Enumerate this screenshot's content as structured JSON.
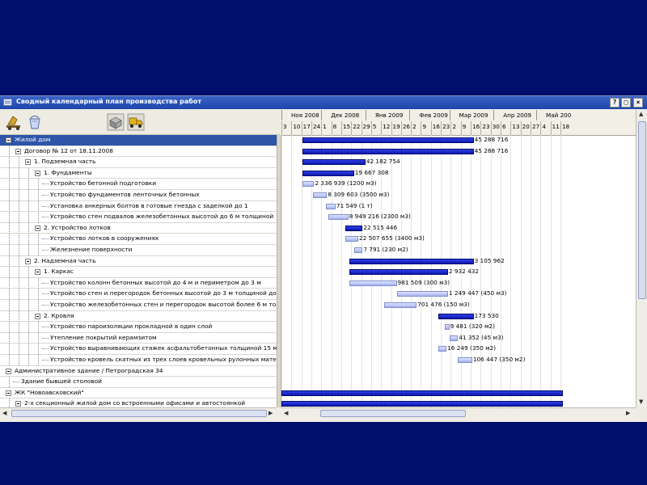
{
  "window": {
    "title": "Сводный календарный план производства работ",
    "buttons": [
      "?",
      "□",
      "×"
    ]
  },
  "toolbar": {
    "icons": [
      "cement-mixer-icon",
      "bucket-icon",
      "bricks-icon",
      "dump-truck-icon"
    ]
  },
  "tree": [
    {
      "label": "Жилой дом",
      "level": 0,
      "expanded": true,
      "selected": true
    },
    {
      "label": "Договор № 12 от 18.11.2008",
      "level": 1,
      "expanded": true
    },
    {
      "label": "1. Подземная часть",
      "level": 2,
      "expanded": true
    },
    {
      "label": "1. Фундаменты",
      "level": 3,
      "expanded": true
    },
    {
      "label": "Устройство бетонной подготовки",
      "level": 4
    },
    {
      "label": "Устройство фундаментов ленточных бетонных",
      "level": 4
    },
    {
      "label": "Установка анкерных болтов в готовые гнезда с заделкой до 1",
      "level": 4
    },
    {
      "label": "Устройство стен подвалов железобетонных высотой до 6 м толщиной",
      "level": 4
    },
    {
      "label": "2. Устройство лотков",
      "level": 3,
      "expanded": true
    },
    {
      "label": "Устройство лотков в сооружениях",
      "level": 4
    },
    {
      "label": "Железнение поверхности",
      "level": 4
    },
    {
      "label": "2. Надземная часть",
      "level": 2,
      "expanded": true
    },
    {
      "label": "1. Каркас",
      "level": 3,
      "expanded": true
    },
    {
      "label": "Устройство колонн бетонных высотой до 4 м и периметром до 3 м",
      "level": 4
    },
    {
      "label": "Устройство стен и перегородок бетонных высотой до 3 м толщиной до",
      "level": 4
    },
    {
      "label": "Устройство железобетонных стен и перегородок высотой более 6 м тол",
      "level": 4
    },
    {
      "label": "2. Кровля",
      "level": 3,
      "expanded": true
    },
    {
      "label": "Устройство пароизоляции прокладной в один слой",
      "level": 4
    },
    {
      "label": "Утепление покрытий керамзитом",
      "level": 4
    },
    {
      "label": "Устройство выравнивающих стяжек асфальтобетонных толщиной 15 м",
      "level": 4
    },
    {
      "label": "Устройство кровель скатных из трех слоев кровельных рулонных мате",
      "level": 4
    },
    {
      "label": "Административное здание / Петроградская 34",
      "level": 0,
      "expanded": true
    },
    {
      "label": "Здание бывшей столовой",
      "level": 1,
      "leafline": true
    },
    {
      "label": "ЖК \"Новоавсковский\"",
      "level": 0,
      "expanded": true
    },
    {
      "label": "2-х секционный жилой дом со встроенными офисами и автостоянкой",
      "level": 1,
      "expanded": true
    }
  ],
  "timeline": {
    "months": [
      "Ноя 2008",
      "Дек 2008",
      "Янв 2009",
      "Фев 2009",
      "Мар 2009",
      "Апр 2009",
      "Май 200"
    ],
    "days": [
      "3",
      "10",
      "17",
      "24",
      "1",
      "8",
      "15",
      "22",
      "29",
      "5",
      "12",
      "19",
      "26",
      "2",
      "9",
      "16",
      "23",
      "2",
      "9",
      "16",
      "23",
      "30",
      "6",
      "13",
      "20",
      "27",
      "4",
      "11",
      "18"
    ]
  },
  "bars": [
    {
      "row": 0,
      "type": "summary",
      "start": "2008-11-18",
      "end": "2009-03-18",
      "label": "45 288 716"
    },
    {
      "row": 1,
      "type": "summary",
      "start": "2008-11-18",
      "end": "2009-03-18",
      "label": "45 288 716"
    },
    {
      "row": 2,
      "type": "summary",
      "start": "2008-11-18",
      "end": "2009-01-01",
      "label": "42 182 754"
    },
    {
      "row": 3,
      "type": "summary",
      "start": "2008-11-18",
      "end": "2008-12-24",
      "label": "19 667 308"
    },
    {
      "row": 4,
      "type": "task",
      "start": "2008-11-18",
      "end": "2008-11-26",
      "label": "2 336 939 (1200 м3)"
    },
    {
      "row": 5,
      "type": "task",
      "start": "2008-11-25",
      "end": "2008-12-05",
      "label": "8 309 603 (3500 м3)"
    },
    {
      "row": 6,
      "type": "task",
      "start": "2008-12-04",
      "end": "2008-12-11",
      "label": "71 549 (1 т)"
    },
    {
      "row": 7,
      "type": "task",
      "start": "2008-12-06",
      "end": "2008-12-20",
      "label": "8 949 216 (2300 м3)"
    },
    {
      "row": 8,
      "type": "summary",
      "start": "2008-12-18",
      "end": "2008-12-30",
      "label": "22 515 446"
    },
    {
      "row": 9,
      "type": "task",
      "start": "2008-12-18",
      "end": "2008-12-27",
      "label": "22 507 655 (3400 м3)"
    },
    {
      "row": 10,
      "type": "task",
      "start": "2008-12-24",
      "end": "2008-12-30",
      "label": "7 791 (230 м2)"
    },
    {
      "row": 11,
      "type": "summary",
      "start": "2008-12-21",
      "end": "2009-03-18",
      "label": "3 105 962"
    },
    {
      "row": 12,
      "type": "summary",
      "start": "2008-12-21",
      "end": "2009-02-28",
      "label": "2 932 432"
    },
    {
      "row": 13,
      "type": "task",
      "start": "2008-12-21",
      "end": "2009-01-23",
      "label": "981 509 (300 м3)"
    },
    {
      "row": 14,
      "type": "task",
      "start": "2009-01-23",
      "end": "2009-02-28",
      "label": "1 249 447 (450 м3)"
    },
    {
      "row": 15,
      "type": "task",
      "start": "2009-01-14",
      "end": "2009-02-06",
      "label": "701 476 (150 м3)"
    },
    {
      "row": 16,
      "type": "summary",
      "start": "2009-02-21",
      "end": "2009-03-18",
      "label": "173 530"
    },
    {
      "row": 17,
      "type": "task",
      "start": "2009-02-26",
      "end": "2009-03-01",
      "label": "9 481 (320 м2)"
    },
    {
      "row": 18,
      "type": "task",
      "start": "2009-03-01",
      "end": "2009-03-07",
      "label": "41 352 (45 м3)"
    },
    {
      "row": 19,
      "type": "task",
      "start": "2009-02-21",
      "end": "2009-02-27",
      "label": "16 249 (350 м2)"
    },
    {
      "row": 20,
      "type": "task",
      "start": "2009-03-07",
      "end": "2009-03-17",
      "label": "106 447 (350 м2)"
    },
    {
      "row": 23,
      "type": "summary",
      "start": "2008-10-30",
      "end": "2009-05-20",
      "label": ""
    },
    {
      "row": 24,
      "type": "summary",
      "start": "2008-11-01",
      "end": "2009-05-20",
      "label": ""
    }
  ],
  "colors": {
    "background": "#000e6b",
    "titlebar": "#1f48ab",
    "summary_bar": "#1424c8",
    "task_bar": "#b6c1f2",
    "selection": "#2d55a8"
  }
}
